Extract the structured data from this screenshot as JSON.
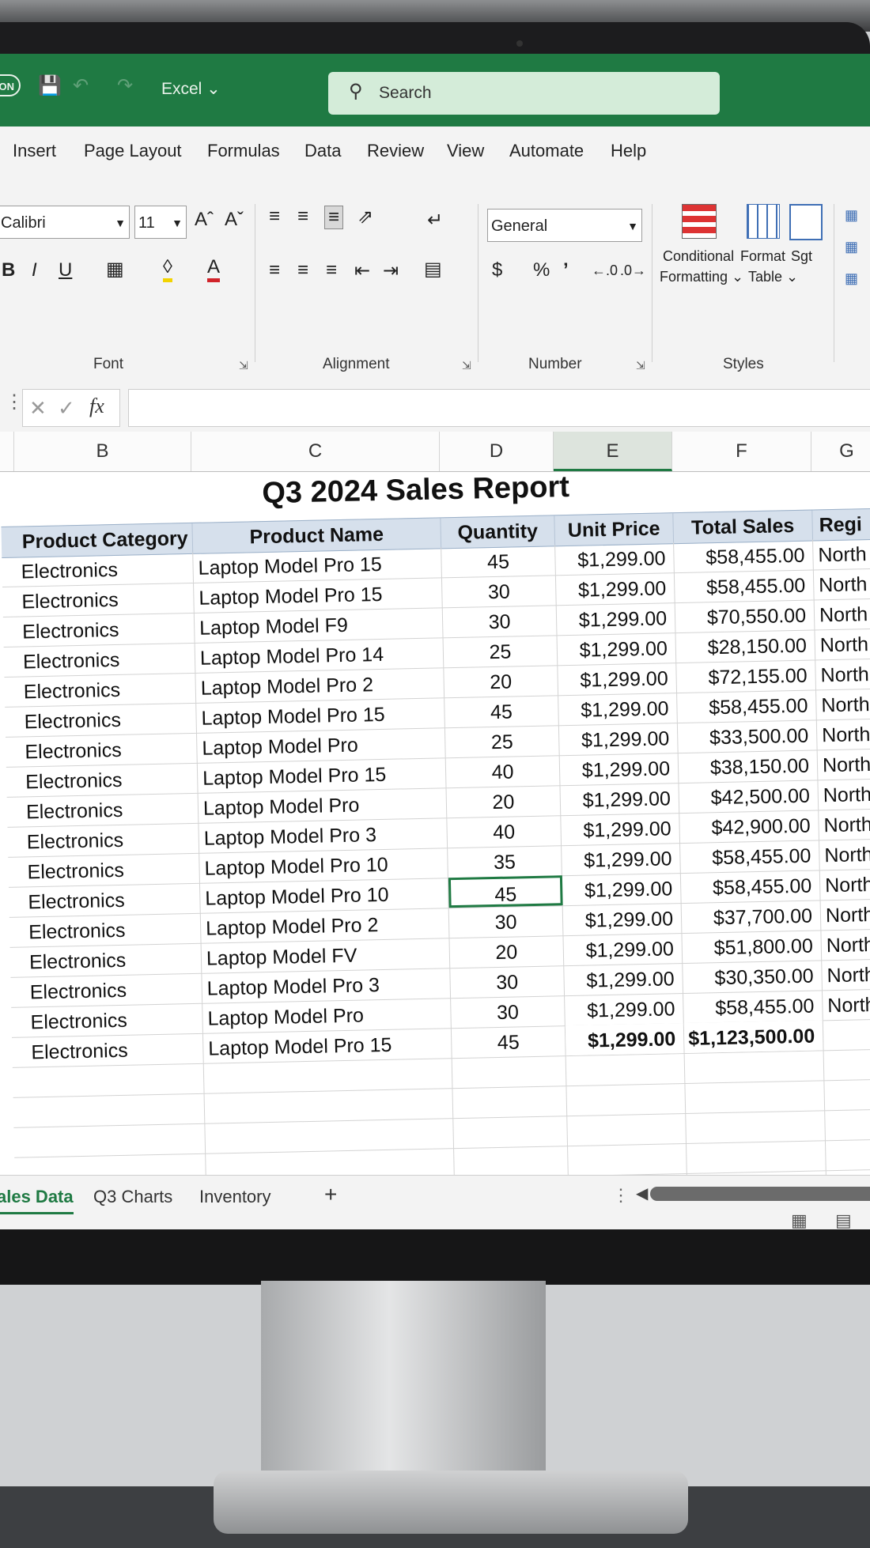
{
  "titlebar": {
    "autosave": "ON",
    "app_name": "Excel ⌄",
    "search_placeholder": "Search"
  },
  "menu_tabs": [
    "Insert",
    "Page Layout",
    "Formulas",
    "Data",
    "Review",
    "View",
    "Automate",
    "Help"
  ],
  "ribbon": {
    "font_name": "Calibri",
    "font_size": "11",
    "number_format": "General",
    "groups": {
      "font": "Font",
      "alignment": "Alignment",
      "number": "Number",
      "styles": "Styles"
    },
    "bold": "B",
    "italic": "I",
    "underline": "U",
    "grow_font": "Aˆ",
    "shrink_font": "Aˇ",
    "currency": "$",
    "percent": "%",
    "comma": "’",
    "conditional_formatting": [
      "Conditional",
      "Formatting ⌄"
    ],
    "format_table": [
      "Format",
      "Table ⌄"
    ],
    "cell_styles": "Sgt"
  },
  "formula_bar": {
    "cancel": "✕",
    "enter": "✓",
    "fx": "fx",
    "value": ""
  },
  "columns": [
    "B",
    "C",
    "D",
    "E",
    "F",
    "G"
  ],
  "selected_column": "E",
  "sheet": {
    "title": "Q3 2024 Sales Report",
    "headers": [
      "Product Category",
      "Product Name",
      "Quantity",
      "Unit Price",
      "Total Sales",
      "Regi"
    ],
    "rows": [
      [
        "Electronics",
        "Laptop Model Pro 15",
        "45",
        "$1,299.00",
        "$58,455.00",
        "North"
      ],
      [
        "Electronics",
        "Laptop Model Pro 15",
        "30",
        "$1,299.00",
        "$58,455.00",
        "North"
      ],
      [
        "Electronics",
        "Laptop Model F9",
        "30",
        "$1,299.00",
        "$70,550.00",
        "North"
      ],
      [
        "Electronics",
        "Laptop Model Pro 14",
        "25",
        "$1,299.00",
        "$28,150.00",
        "North"
      ],
      [
        "Electronics",
        "Laptop Model Pro 2",
        "20",
        "$1,299.00",
        "$72,155.00",
        "North"
      ],
      [
        "Electronics",
        "Laptop Model Pro 15",
        "45",
        "$1,299.00",
        "$58,455.00",
        "North"
      ],
      [
        "Electronics",
        "Laptop Model Pro",
        "25",
        "$1,299.00",
        "$33,500.00",
        "North"
      ],
      [
        "Electronics",
        "Laptop Model Pro 15",
        "40",
        "$1,299.00",
        "$38,150.00",
        "North"
      ],
      [
        "Electronics",
        "Laptop Model Pro",
        "20",
        "$1,299.00",
        "$42,500.00",
        "North"
      ],
      [
        "Electronics",
        "Laptop Model Pro 3",
        "40",
        "$1,299.00",
        "$42,900.00",
        "North"
      ],
      [
        "Electronics",
        "Laptop Model Pro 10",
        "35",
        "$1,299.00",
        "$58,455.00",
        "North"
      ],
      [
        "Electronics",
        "Laptop Model Pro 10",
        "45",
        "$1,299.00",
        "$58,455.00",
        "North"
      ],
      [
        "Electronics",
        "Laptop Model Pro 2",
        "30",
        "$1,299.00",
        "$37,700.00",
        "North"
      ],
      [
        "Electronics",
        "Laptop Model FV",
        "20",
        "$1,299.00",
        "$51,800.00",
        "North"
      ],
      [
        "Electronics",
        "Laptop Model Pro 3",
        "30",
        "$1,299.00",
        "$30,350.00",
        "North"
      ],
      [
        "Electronics",
        "Laptop Model Pro",
        "30",
        "$1,299.00",
        "$58,455.00",
        "North"
      ],
      [
        "Electronics",
        "Laptop Model Pro 15",
        "45",
        "",
        "",
        ""
      ]
    ],
    "totals": {
      "unit_price": "$1,299.00",
      "total_sales": "$1,123,500.00"
    }
  },
  "sheet_tabs": [
    "ales Data",
    "Q3 Charts",
    "Inventory"
  ],
  "add_sheet": "+",
  "colors": {
    "excel_green": "#1f7a43",
    "header_fill": "#d6e0ec",
    "search_fill": "#d4ecd9"
  }
}
